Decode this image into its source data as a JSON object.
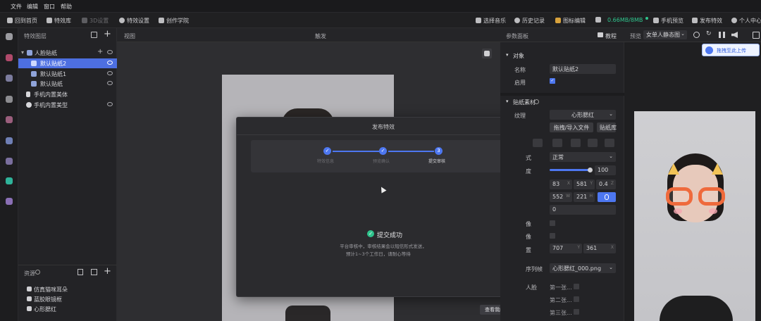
{
  "menu": [
    "文件",
    "编辑",
    "窗口",
    "帮助"
  ],
  "toolbar": {
    "home": "回到首页",
    "library": "特效库",
    "settings_3d": "3D设置",
    "effect_settings": "特效设置",
    "academy": "创作学院",
    "music": "选择音乐",
    "history": "历史记录",
    "sticker_edit": "图标编辑",
    "memory": "0.66MB/8MB",
    "phone_preview": "手机预览",
    "publish": "发布特效",
    "user": "个人中心"
  },
  "layers": {
    "title": "特效图层",
    "items": [
      {
        "label": "人脸贴纸",
        "depth": 0,
        "selected": false
      },
      {
        "label": "默认贴纸2",
        "depth": 1,
        "selected": true
      },
      {
        "label": "默认贴纸1",
        "depth": 1,
        "selected": false
      },
      {
        "label": "默认贴纸",
        "depth": 1,
        "selected": false
      },
      {
        "label": "手机内置美体",
        "depth": 0,
        "selected": false
      },
      {
        "label": "手机内置美型",
        "depth": 0,
        "selected": false
      }
    ]
  },
  "resources": {
    "title": "资源",
    "items": [
      "仿真猫咪耳朵",
      "蓝胶眼镜框",
      "心形腮红"
    ]
  },
  "viewport": {
    "title": "视图",
    "tab": "触发"
  },
  "modal": {
    "title": "发布特效",
    "steps": [
      "特效信息",
      "预览确认",
      "提交审核"
    ],
    "success": "提交成功",
    "line1": "平台审核中，审核结果会以短信形式发送，",
    "line2": "预计1~3个工作日，请耐心等待",
    "view_button": "查看我的特效"
  },
  "properties": {
    "title": "参数面板",
    "tutorial": "教程",
    "object_section": "对象",
    "name_label": "名称",
    "name_value": "默认贴纸2",
    "enable_label": "启用",
    "material_section": "贴纸素材",
    "texture_label": "纹理",
    "texture_value": "心形腮红",
    "drag_import": "拖拽/导入文件",
    "sticker_lib": "贴纸库",
    "blend_label": "式",
    "blend_value": "正常",
    "opacity_label": "度",
    "opacity_value": "100",
    "opacity_level": 1.0,
    "pos_x": "83",
    "pos_x_lbl": "X",
    "pos_y": "581",
    "pos_y_lbl": "Y",
    "pos_z": "0.4",
    "pos_z_lbl": "Z",
    "size_w": "552",
    "size_w_lbl": "W",
    "size_h": "221",
    "size_h_lbl": "H",
    "rotation": "0",
    "flip1_lbl": "像",
    "flip2_lbl": "像",
    "anchor_lbl": "置",
    "anchor_x": "707",
    "anchor_x_lbl": "Y",
    "anchor_y": "361",
    "anchor_y_lbl": "X",
    "frames_lbl": "序列帧",
    "frames_value": "心形腮红_000.png",
    "face_lbl": "人脸",
    "face_opts": [
      "第一张...",
      "第二张...",
      "第三张..."
    ]
  },
  "preview": {
    "label": "预览",
    "model": "女单人静态图",
    "upload": "拖拽至此上传"
  },
  "colors": {
    "accent": "#4d77f0",
    "success": "#2fc48d"
  }
}
